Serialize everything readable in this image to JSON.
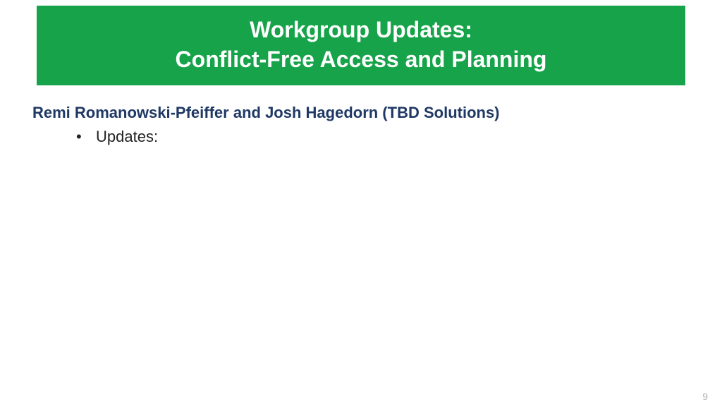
{
  "title": {
    "line1": "Workgroup Updates:",
    "line2": "Conflict-Free Access and Planning"
  },
  "subheading": "Remi Romanowski-Pfeiffer and Josh Hagedorn (TBD Solutions)",
  "bullets": {
    "item0": "Updates:"
  },
  "page_number": "9"
}
